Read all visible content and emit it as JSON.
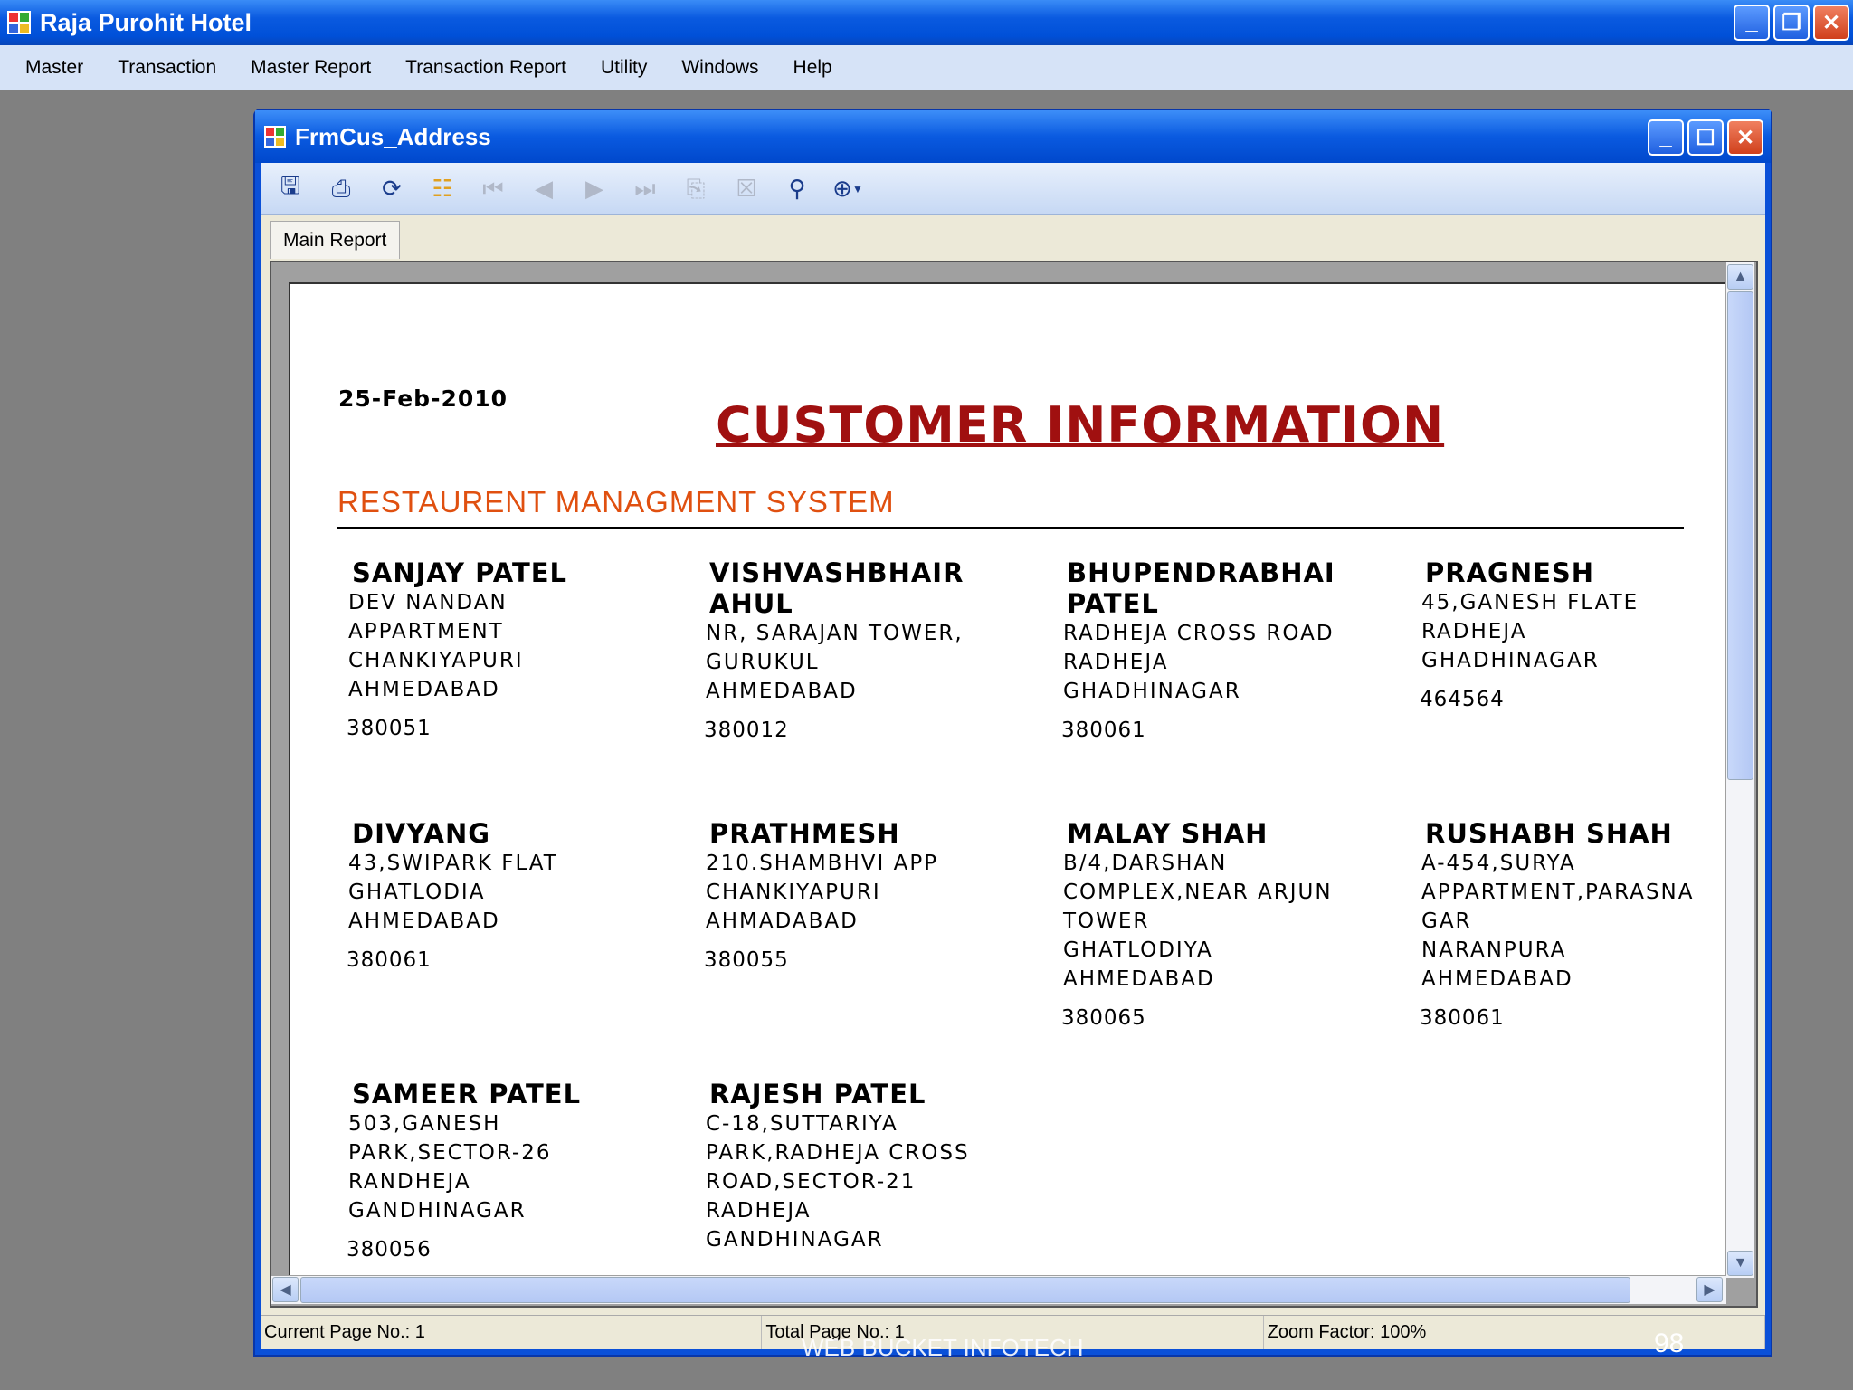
{
  "app": {
    "title": "Raja Purohit Hotel"
  },
  "menu": [
    "Master",
    "Transaction",
    "Master Report",
    "Transaction Report",
    "Utility",
    "Windows",
    "Help"
  ],
  "child": {
    "title": "FrmCus_Address"
  },
  "toolbar": {
    "icons": [
      "export-icon",
      "print-icon",
      "refresh-icon",
      "group-tree-icon",
      "first-page-icon",
      "previous-page-icon",
      "next-page-icon",
      "last-page-icon",
      "goto-page-icon",
      "stop-icon",
      "search-icon",
      "zoom-icon"
    ]
  },
  "tab": "Main Report",
  "report": {
    "date": "25-Feb-2010",
    "title": "CUSTOMER INFORMATION",
    "subtitle": "RESTAURENT MANAGMENT SYSTEM",
    "customers": [
      {
        "name": "SANJAY PATEL",
        "address": [
          "DEV NANDAN",
          "APPARTMENT",
          "CHANKIYAPURI",
          "AHMEDABAD"
        ],
        "zip": "380051"
      },
      {
        "name": "VISHVASHBHAIR AHUL",
        "address": [
          "NR, SARAJAN TOWER,",
          "GURUKUL",
          "AHMEDABAD"
        ],
        "zip": "380012"
      },
      {
        "name": "BHUPENDRABHAI PATEL",
        "address": [
          "RADHEJA CROSS ROAD",
          "RADHEJA",
          "GHADHINAGAR"
        ],
        "zip": "380061"
      },
      {
        "name": "PRAGNESH",
        "address": [
          "45,GANESH FLATE",
          "RADHEJA",
          "GHADHINAGAR"
        ],
        "zip": "464564"
      },
      {
        "name": "DIVYANG",
        "address": [
          "43,SWIPARK FLAT",
          "GHATLODIA",
          "AHMEDABAD"
        ],
        "zip": "380061"
      },
      {
        "name": "PRATHMESH",
        "address": [
          "210.SHAMBHVI APP",
          "CHANKIYAPURI",
          "AHMADABAD"
        ],
        "zip": "380055"
      },
      {
        "name": "MALAY SHAH",
        "address": [
          "B/4,DARSHAN",
          "COMPLEX,NEAR ARJUN",
          "TOWER",
          "GHATLODIYA",
          "AHMEDABAD"
        ],
        "zip": "380065"
      },
      {
        "name": "RUSHABH SHAH",
        "address": [
          "A-454,SURYA",
          "APPARTMENT,PARASNA",
          "GAR",
          "NARANPURA",
          "AHMEDABAD"
        ],
        "zip": "380061"
      },
      {
        "name": "SAMEER PATEL",
        "address": [
          "503,GANESH",
          "PARK,SECTOR-26",
          "RANDHEJA",
          "GANDHINAGAR"
        ],
        "zip": "380056"
      },
      {
        "name": "RAJESH PATEL",
        "address": [
          "C-18,SUTTARIYA",
          "PARK,RADHEJA CROSS",
          "ROAD,SECTOR-21",
          "RADHEJA",
          "GANDHINAGAR"
        ],
        "zip": ""
      }
    ]
  },
  "status": {
    "current_page": "Current Page No.: 1",
    "total_page": "Total Page No.: 1",
    "zoom": "Zoom Factor: 100%"
  },
  "overlay": {
    "watermark": "WEB BUCKET INFOTECH",
    "page_number": "98"
  }
}
